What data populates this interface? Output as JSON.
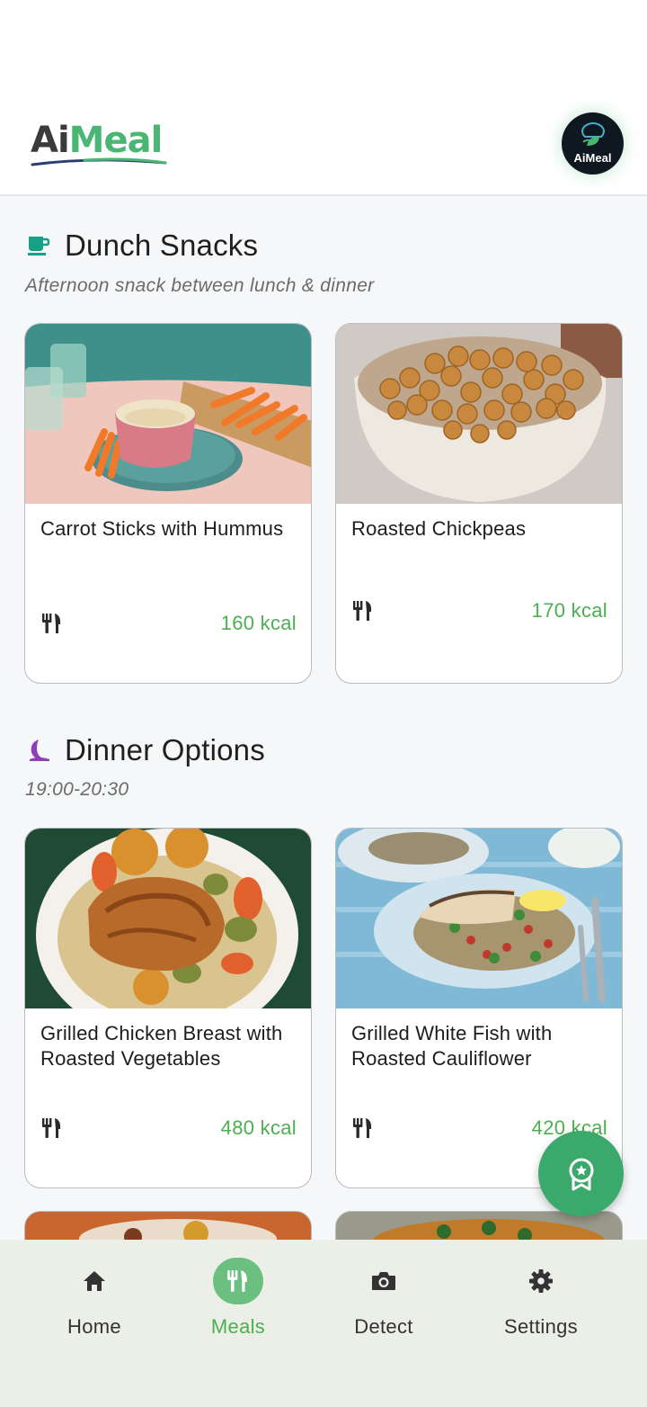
{
  "header": {
    "logo_ai": "Ai",
    "logo_meal": "Meal",
    "avatar_label": "AiMeal"
  },
  "sections": [
    {
      "title": "Dunch Snacks",
      "subtitle": "Afternoon snack between lunch & dinner",
      "icon": "coffee-cup-icon",
      "items": [
        {
          "name": "Carrot Sticks with Hummus",
          "kcal": "160 kcal"
        },
        {
          "name": "Roasted Chickpeas",
          "kcal": "170 kcal"
        }
      ]
    },
    {
      "title": "Dinner Options",
      "subtitle": "19:00-20:30",
      "icon": "moon-icon",
      "items": [
        {
          "name": "Grilled Chicken Breast with Roasted Vegetables",
          "kcal": "480 kcal"
        },
        {
          "name": "Grilled White Fish with Roasted Cauliflower",
          "kcal": "420 kcal"
        }
      ]
    }
  ],
  "nav": {
    "items": [
      {
        "label": "Home",
        "icon": "home-icon"
      },
      {
        "label": "Meals",
        "icon": "utensils-icon",
        "active": true
      },
      {
        "label": "Detect",
        "icon": "camera-icon"
      },
      {
        "label": "Settings",
        "icon": "gear-icon"
      }
    ]
  },
  "colors": {
    "accent": "#4caf50",
    "fab": "#3aa96b",
    "nav_bg": "#ebefe7",
    "page_bg": "#f5f7f9"
  }
}
